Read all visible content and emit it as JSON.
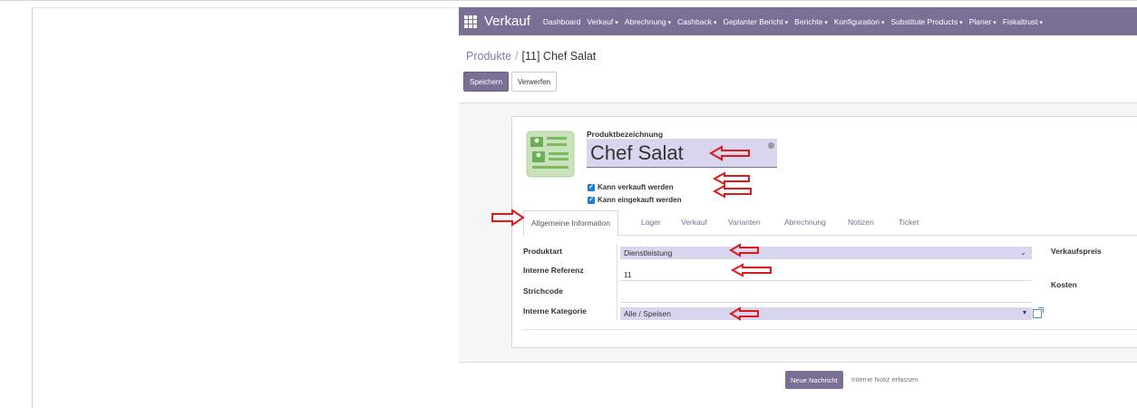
{
  "navbar": {
    "app_name": "Verkauf",
    "menu": [
      {
        "label": "Dashboard",
        "has_caret": false
      },
      {
        "label": "Verkauf",
        "has_caret": true
      },
      {
        "label": "Abrechnung",
        "has_caret": true
      },
      {
        "label": "Cashback",
        "has_caret": true
      },
      {
        "label": "Geplanter Bericht",
        "has_caret": true
      },
      {
        "label": "Berichte",
        "has_caret": true
      },
      {
        "label": "Konfiguration",
        "has_caret": true
      },
      {
        "label": "Substitute Products",
        "has_caret": true
      },
      {
        "label": "Planer",
        "has_caret": true
      },
      {
        "label": "Fiskaltrust",
        "has_caret": true
      }
    ]
  },
  "breadcrumb": {
    "parent": "Produkte",
    "separator": "/",
    "current": "[11] Chef Salat"
  },
  "buttons": {
    "save": "Speichern",
    "discard": "Verwerfen"
  },
  "form": {
    "title_label": "Produktbezeichnung",
    "title_value": "Chef Salat",
    "checkboxes": [
      {
        "label": "Kann verkauft werden",
        "checked": true
      },
      {
        "label": "Kann eingekauft werden",
        "checked": true
      }
    ],
    "tabs": [
      "Allgemeine Information",
      "Lager",
      "Verkauf",
      "Varianten",
      "Abrechnung",
      "Notizen",
      "Ticket"
    ],
    "active_tab": "Allgemeine Information",
    "fields": {
      "product_type": {
        "label": "Produktart",
        "value": "Dienstleistung"
      },
      "internal_ref": {
        "label": "Interne Referenz",
        "value": "11"
      },
      "barcode": {
        "label": "Strichcode",
        "value": ""
      },
      "category": {
        "label": "Interne Kategorie",
        "value": "Alle / Speisen"
      },
      "sales_price": {
        "label": "Verkaufspreis"
      },
      "cost": {
        "label": "Kosten"
      }
    }
  },
  "chatter": {
    "new_message": "Neue Nachricht",
    "log_note": "Interne Notiz erfassen"
  },
  "colors": {
    "brand": "#7c6f95",
    "field_highlight": "#d8d5ee",
    "annotation_arrow": "#e0181b",
    "checkbox": "#1c7ed6"
  },
  "icons": [
    "apps-grid-icon",
    "caret-down-icon",
    "product-card-icon",
    "translate-globe-icon",
    "checkbox-checked-icon",
    "external-link-icon",
    "annotation-arrow-icon"
  ]
}
